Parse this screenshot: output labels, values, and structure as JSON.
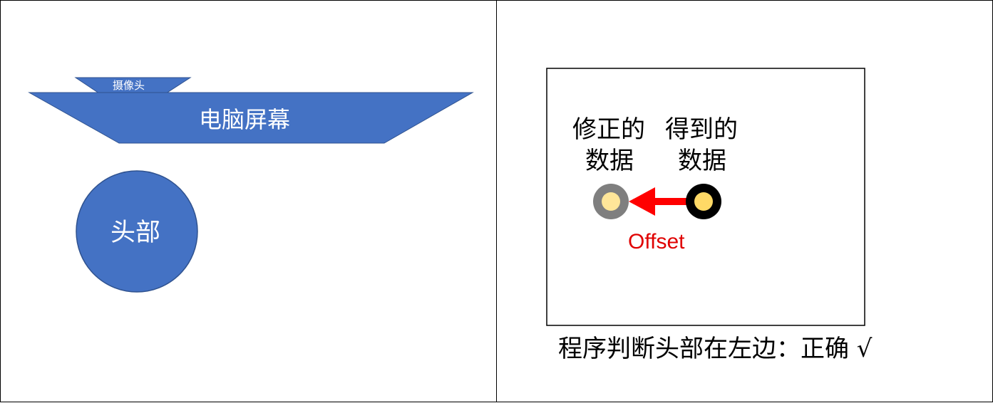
{
  "left": {
    "camera_label": "摄像头",
    "screen_label": "电脑屏幕",
    "head_label": "头部"
  },
  "right": {
    "corrected_label_line1": "修正的",
    "corrected_label_line2": "数据",
    "obtained_label_line1": "得到的",
    "obtained_label_line2": "数据",
    "offset_label": "Offset",
    "result_text": "程序判断头部在左边：正确 √"
  },
  "colors": {
    "shape_fill": "#4472C4",
    "shape_stroke": "#2F528F",
    "arrow": "#FF0000",
    "offset_text": "#E00000",
    "dot_inner": "#FFD966",
    "dot_inner_light": "#FFE699",
    "dot_ring_dark": "#000000",
    "dot_ring_gray": "#7F7F7F"
  }
}
